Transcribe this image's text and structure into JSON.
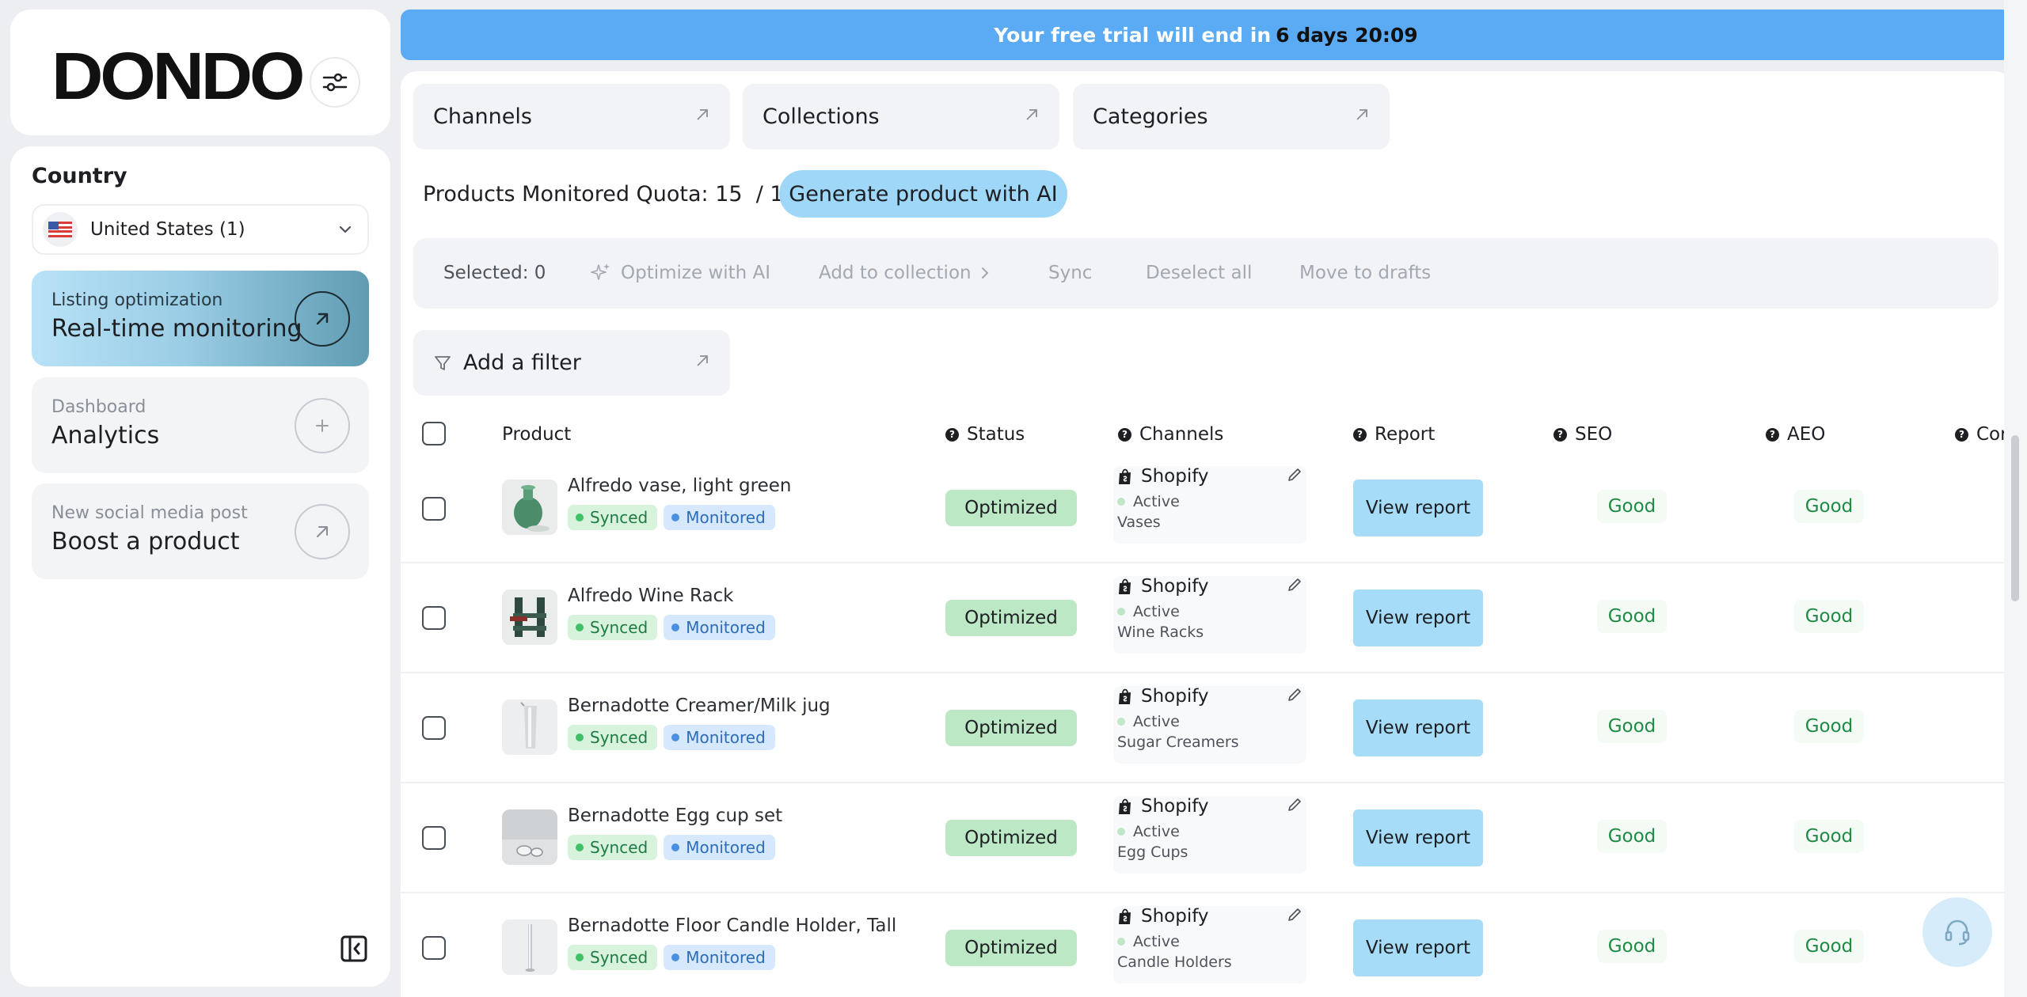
{
  "brand": {
    "logo": "DONDO"
  },
  "sidebar": {
    "country_label": "Country",
    "country_value": "United States (1)",
    "nav": [
      {
        "small": "Listing optimization",
        "big": "Real-time monitoring",
        "icon": "arrow-up-right-icon"
      },
      {
        "small": "Dashboard",
        "big": "Analytics",
        "icon": "plus-icon"
      },
      {
        "small": "New social media post",
        "big": "Boost a product",
        "icon": "arrow-up-right-icon"
      }
    ]
  },
  "banner": {
    "text": "Your free trial will end in",
    "time": "6 days 20:09"
  },
  "toplinks": [
    "Channels",
    "Collections",
    "Categories"
  ],
  "quota": {
    "text": "Products Monitored Quota: 15  / 15"
  },
  "generate_button": "Generate product with AI",
  "actions": {
    "selected": "Selected: 0",
    "optimize": "Optimize with AI",
    "add_collection": "Add to collection",
    "sync": "Sync",
    "deselect": "Deselect all",
    "drafts": "Move to drafts"
  },
  "filter": {
    "label": "Add a filter"
  },
  "table": {
    "headers": [
      "Product",
      "Status",
      "Channels",
      "Report",
      "SEO",
      "AEO",
      "Cor"
    ],
    "rows": [
      {
        "name": "Alfredo vase, light green",
        "tag1": "Synced",
        "tag2": "Monitored",
        "status": "Optimized",
        "channel": "Shopify",
        "channel_status": "Active",
        "category": "Vases",
        "report": "View report",
        "seo": "Good",
        "aeo": "Good"
      },
      {
        "name": "Alfredo Wine Rack",
        "tag1": "Synced",
        "tag2": "Monitored",
        "status": "Optimized",
        "channel": "Shopify",
        "channel_status": "Active",
        "category": "Wine Racks",
        "report": "View report",
        "seo": "Good",
        "aeo": "Good"
      },
      {
        "name": "Bernadotte Creamer/Milk jug",
        "tag1": "Synced",
        "tag2": "Monitored",
        "status": "Optimized",
        "channel": "Shopify",
        "channel_status": "Active",
        "category": "Sugar Creamers",
        "report": "View report",
        "seo": "Good",
        "aeo": "Good"
      },
      {
        "name": "Bernadotte Egg cup set",
        "tag1": "Synced",
        "tag2": "Monitored",
        "status": "Optimized",
        "channel": "Shopify",
        "channel_status": "Active",
        "category": "Egg Cups",
        "report": "View report",
        "seo": "Good",
        "aeo": "Good"
      },
      {
        "name": "Bernadotte Floor Candle Holder, Tall",
        "tag1": "Synced",
        "tag2": "Monitored",
        "status": "Optimized",
        "channel": "Shopify",
        "channel_status": "Active",
        "category": "Candle Holders",
        "report": "View report",
        "seo": "Good",
        "aeo": "Good"
      }
    ]
  },
  "colors": {
    "banner": "#5aaaf4",
    "accent": "#9ed7f8",
    "status_bg": "#bde8c6",
    "good_text": "#1f8a45"
  }
}
